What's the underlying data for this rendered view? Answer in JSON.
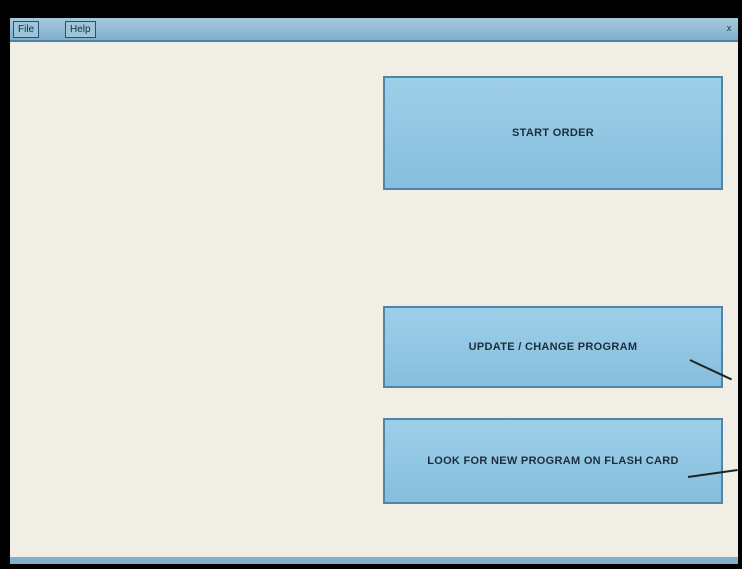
{
  "menu": {
    "file_label": "File",
    "help_label": "Help"
  },
  "window": {
    "close_label": "x"
  },
  "buttons": {
    "start_order": "START ORDER",
    "update_program": "UPDATE / CHANGE PROGRAM",
    "look_new_program": "LOOK FOR NEW PROGRAM ON FLASH CARD"
  },
  "colors": {
    "screen_background": "#f1eee6",
    "menubar": "#7fb0cc",
    "button_fill": "#93c6e3",
    "button_border": "#4d86aa"
  }
}
